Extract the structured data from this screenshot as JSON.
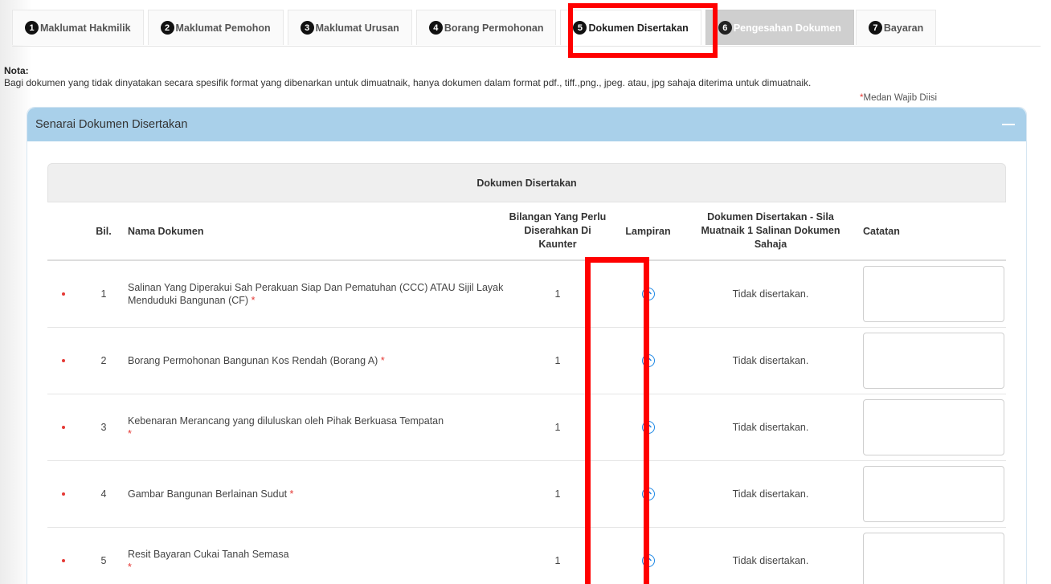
{
  "tabs": [
    {
      "num": "1",
      "label": "Maklumat Hakmilik"
    },
    {
      "num": "2",
      "label": "Maklumat Pemohon"
    },
    {
      "num": "3",
      "label": "Maklumat Urusan"
    },
    {
      "num": "4",
      "label": "Borang Permohonan"
    },
    {
      "num": "5",
      "label": "Dokumen Disertakan"
    },
    {
      "num": "6",
      "label": "Pengesahan Dokumen"
    },
    {
      "num": "7",
      "label": "Bayaran"
    }
  ],
  "nota": {
    "title": "Nota:",
    "text": "Bagi dokumen yang tidak dinyatakan secara spesifik format yang dibenarkan untuk dimuatnaik, hanya dokumen dalam format pdf., tiff.,png., jpeg. atau, jpg sahaja diterima untuk dimuatnaik."
  },
  "required_note": {
    "star": "*",
    "text": "Medan Wajib Diisi"
  },
  "panel": {
    "title": "Senarai Dokumen Disertakan"
  },
  "table": {
    "caption": "Dokumen Disertakan",
    "headers": {
      "bil": "Bil.",
      "nama": "Nama Dokumen",
      "qty": "Bilangan Yang Perlu Diserahkan Di Kaunter",
      "lampiran": "Lampiran",
      "dokumen": "Dokumen Disertakan - Sila Muatnaik 1 Salinan Dokumen Sahaja",
      "catatan": "Catatan"
    },
    "rows": [
      {
        "bil": "1",
        "name": "Salinan Yang Diperakui Sah Perakuan Siap Dan Pematuhan (CCC) ATAU Sijil Layak Menduduki Bangunan (CF)",
        "star": "*",
        "qty": "1",
        "status": "Tidak disertakan."
      },
      {
        "bil": "2",
        "name": "Borang Permohonan Bangunan Kos Rendah (Borang A)",
        "star": "*",
        "qty": "1",
        "status": "Tidak disertakan."
      },
      {
        "bil": "3",
        "name": "Kebenaran Merancang yang diluluskan oleh Pihak Berkuasa Tempatan",
        "star": "*",
        "qty": "1",
        "status": "Tidak disertakan."
      },
      {
        "bil": "4",
        "name": "Gambar Bangunan Berlainan Sudut",
        "star": "*",
        "qty": "1",
        "status": "Tidak disertakan."
      },
      {
        "bil": "5",
        "name": "Resit Bayaran Cukai Tanah Semasa",
        "star": "*",
        "qty": "1",
        "status": "Tidak disertakan."
      }
    ]
  },
  "colors": {
    "highlight": "#ff0000",
    "panel_header": "#a9d0ea",
    "upload_icon": "#1e88e5",
    "required": "#e53935"
  }
}
